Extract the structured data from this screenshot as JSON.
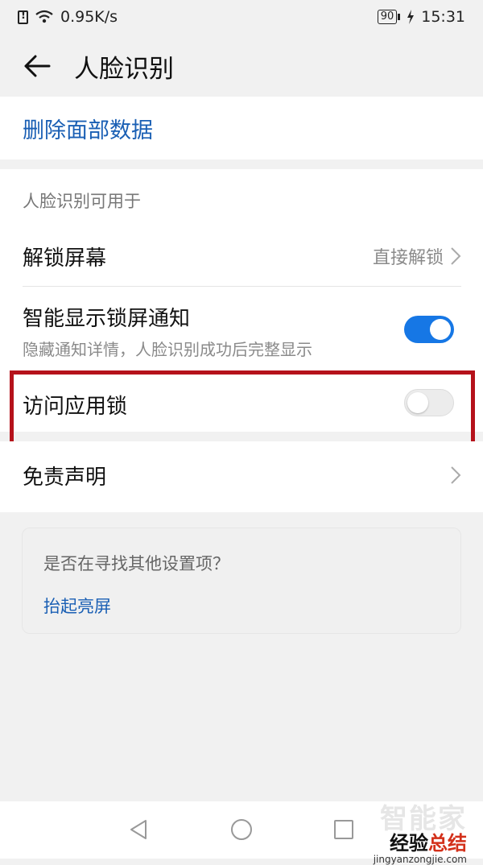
{
  "status_bar": {
    "speed": "0.95K/s",
    "battery": "90",
    "time": "15:31"
  },
  "header": {
    "title": "人脸识别"
  },
  "delete_card": {
    "label": "删除面部数据"
  },
  "section": {
    "header": "人脸识别可用于",
    "rows": [
      {
        "title": "解锁屏幕",
        "value": "直接解锁"
      },
      {
        "title": "智能显示锁屏通知",
        "subtitle": "隐藏通知详情，人脸识别成功后完整显示",
        "toggle": "on"
      },
      {
        "title": "访问应用锁",
        "toggle": "off"
      }
    ]
  },
  "disclaimer": {
    "label": "免责声明"
  },
  "suggestion": {
    "question": "是否在寻找其他设置项？",
    "link": "抬起亮屏"
  },
  "watermark": {
    "top": "智能家",
    "brand_a": "经验",
    "brand_b": "总结",
    "url": "jingyanzongjie.com"
  },
  "colors": {
    "accent": "#1677e5",
    "link": "#1a5fb4",
    "highlight": "#b5121b"
  }
}
